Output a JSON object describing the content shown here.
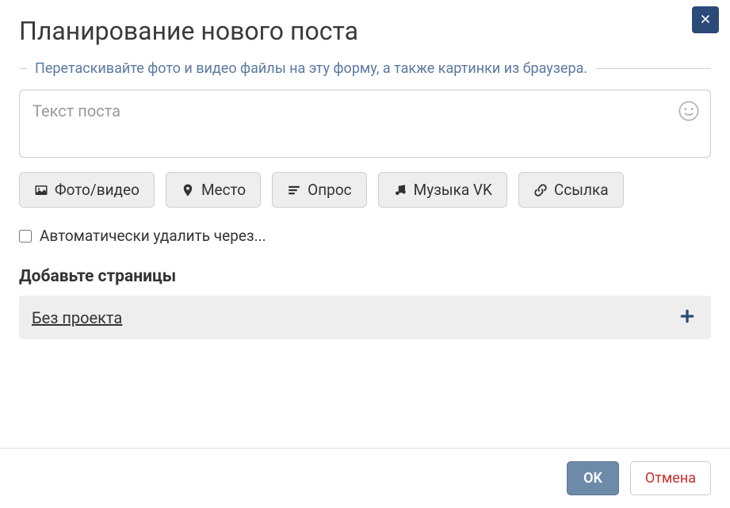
{
  "dialog": {
    "title": "Планирование нового поста",
    "hint": "Перетаскивайте фото и видео файлы на эту форму, а также картинки из браузера."
  },
  "post": {
    "text": "",
    "placeholder": "Текст поста"
  },
  "attachments": {
    "photo_video": "Фото/видео",
    "place": "Место",
    "poll": "Опрос",
    "music": "Музыка VK",
    "link": "Ссылка"
  },
  "auto_delete": {
    "checked": false,
    "label": "Автоматически удалить через..."
  },
  "pages": {
    "section_title": "Добавьте страницы",
    "project": "Без проекта"
  },
  "footer": {
    "ok": "OK",
    "cancel": "Отмена"
  },
  "colors": {
    "close_bg": "#2c4a78",
    "hint_text": "#5b7aa3",
    "ok_bg": "#6d8aa8",
    "cancel_text": "#c9302c",
    "plus": "#2c4a78"
  }
}
